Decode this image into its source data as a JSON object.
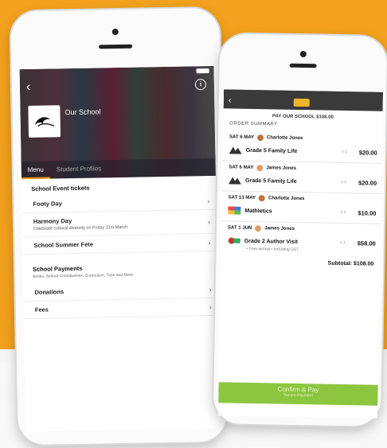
{
  "phone1": {
    "title": "Our School",
    "tabs": [
      {
        "label": "Menu",
        "active": true
      },
      {
        "label": "Student Profiles",
        "active": false
      }
    ],
    "section1": {
      "title": "School Event tickets",
      "items": [
        {
          "label": "Footy Day",
          "desc": ""
        },
        {
          "label": "Harmony Day",
          "desc": "Celebrate cultural diversity on Friday 21st March"
        },
        {
          "label": "School Summer Fete",
          "desc": ""
        }
      ]
    },
    "section2": {
      "title": "School Payments",
      "subtitle": "Books, School Contributions, Curriculum, Trips and More",
      "items": [
        {
          "label": "Donations"
        },
        {
          "label": "Fees"
        }
      ]
    }
  },
  "phone2": {
    "title": "PAY OUR SCHOOL $108.00",
    "order_summary": "ORDER SUMMARY",
    "groups": [
      {
        "date": "SAT 6 MAY",
        "student": "Charlotte Jones",
        "item": "Grade 5 Family Life",
        "qty": "x 1",
        "price": "$20.00"
      },
      {
        "date": "SAT 6 MAY",
        "student": "James Jones",
        "item": "Grade 5 Family Life",
        "qty": "x 1",
        "price": "$20.00"
      },
      {
        "date": "SAT 13 MAY",
        "student": "Charlotte Jones",
        "item": "Mathletics",
        "qty": "x 1",
        "price": "$10.00"
      },
      {
        "date": "SAT 1 JUN",
        "student": "James Jones",
        "item": "Grade 2 Author Visit",
        "qty": "x 1",
        "price": "$58.00",
        "note": "• Free airmail • Including GST"
      }
    ],
    "subtotal": "Subtotal: $108.00",
    "confirm_label": "Confirm & Pay",
    "confirm_sub": "Secure Payment"
  },
  "colors": {
    "background": "#f2a21e",
    "tab_accent": "#f39c12",
    "confirm": "#8cc63f"
  }
}
